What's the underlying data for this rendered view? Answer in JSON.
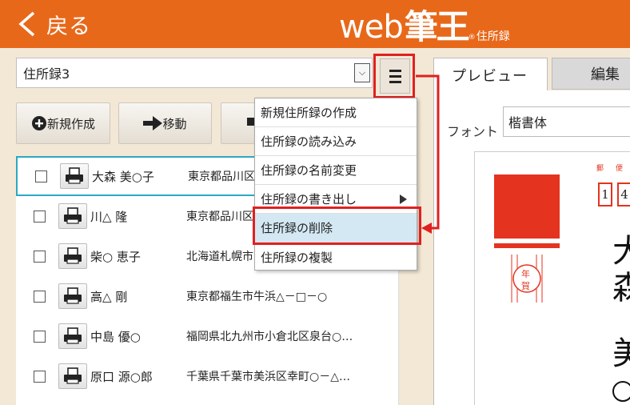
{
  "header": {
    "back_label": "戻る",
    "logo_web": "web",
    "logo_fude": "筆王",
    "logo_reg": "®",
    "logo_sub": "住所録"
  },
  "addressbook": {
    "selected": "住所録3"
  },
  "toolbar": {
    "new_label": "新規作成",
    "move_label": "移動"
  },
  "contacts": [
    {
      "name": "大森 美○子",
      "address": "東京都品川区"
    },
    {
      "name": "川△ 隆",
      "address": "東京都品川区"
    },
    {
      "name": "柴○ 恵子",
      "address": "北海道札幌市"
    },
    {
      "name": "高△ 剛",
      "address": "東京都福生市牛浜△－□－○"
    },
    {
      "name": "中島 優○",
      "address": "福岡県北九州市小倉北区泉台○…"
    },
    {
      "name": "原口 源○郎",
      "address": "千葉県千葉市美浜区幸町○－△…"
    }
  ],
  "menu": {
    "items": [
      {
        "label": "新規住所録の作成"
      },
      {
        "label": "住所録の読み込み"
      },
      {
        "label": "住所録の名前変更"
      },
      {
        "label": "住所録の書き出し"
      },
      {
        "label": "住所録の削除"
      },
      {
        "label": "住所録の複製"
      }
    ]
  },
  "preview": {
    "tab_preview": "プレビュー",
    "tab_edit": "編集",
    "font_label": "フォント",
    "font_value": "楷書体",
    "postal_label_1": "郵",
    "postal_label_2": "便",
    "zip_digits": [
      "1",
      "4"
    ],
    "nenga_1": "年",
    "nenga_2": "賀",
    "vertical_chars": [
      "大",
      "森",
      "美"
    ]
  },
  "colors": {
    "header": "#e8681a",
    "highlight": "#e02020",
    "stamp": "#e4331f",
    "selection": "#2aa8c6"
  }
}
